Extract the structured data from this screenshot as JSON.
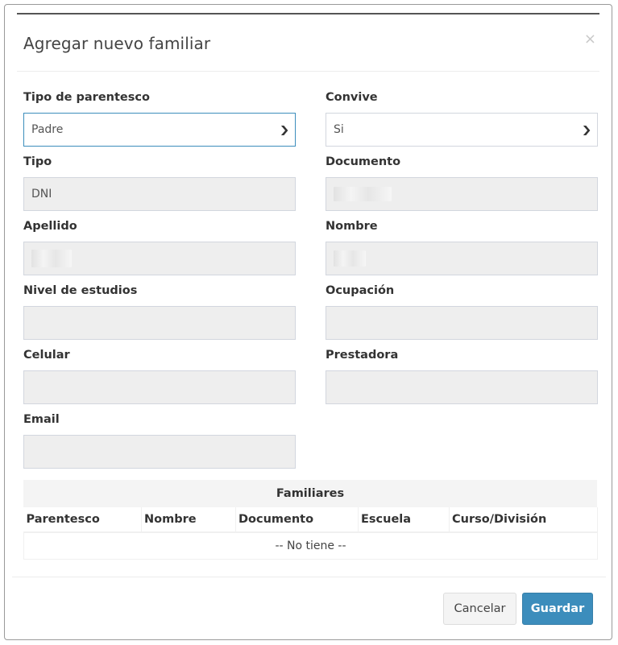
{
  "modal": {
    "title": "Agregar nuevo familiar",
    "close": "×"
  },
  "form": {
    "tipo_parentesco": {
      "label": "Tipo de parentesco",
      "value": "Padre"
    },
    "convive": {
      "label": "Convive",
      "value": "Si"
    },
    "tipo": {
      "label": "Tipo",
      "value": "DNI"
    },
    "documento": {
      "label": "Documento",
      "value": ""
    },
    "apellido": {
      "label": "Apellido",
      "value": ""
    },
    "nombre": {
      "label": "Nombre",
      "value": ""
    },
    "nivel_estudios": {
      "label": "Nivel de estudios",
      "value": ""
    },
    "ocupacion": {
      "label": "Ocupación",
      "value": ""
    },
    "celular": {
      "label": "Celular",
      "value": ""
    },
    "prestadora": {
      "label": "Prestadora",
      "value": ""
    },
    "email": {
      "label": "Email",
      "value": ""
    }
  },
  "familiares_table": {
    "caption": "Familiares",
    "columns": [
      "Parentesco",
      "Nombre",
      "Documento",
      "Escuela",
      "Curso/División"
    ],
    "empty_text": "-- No tiene --"
  },
  "footer": {
    "cancel_label": "Cancelar",
    "save_label": "Guardar"
  },
  "colors": {
    "primary": "#3c8dbc",
    "readonly_bg": "#eeeeee"
  },
  "icons": {
    "close": "close-icon",
    "select_arrow": "chevron-down-icon"
  }
}
